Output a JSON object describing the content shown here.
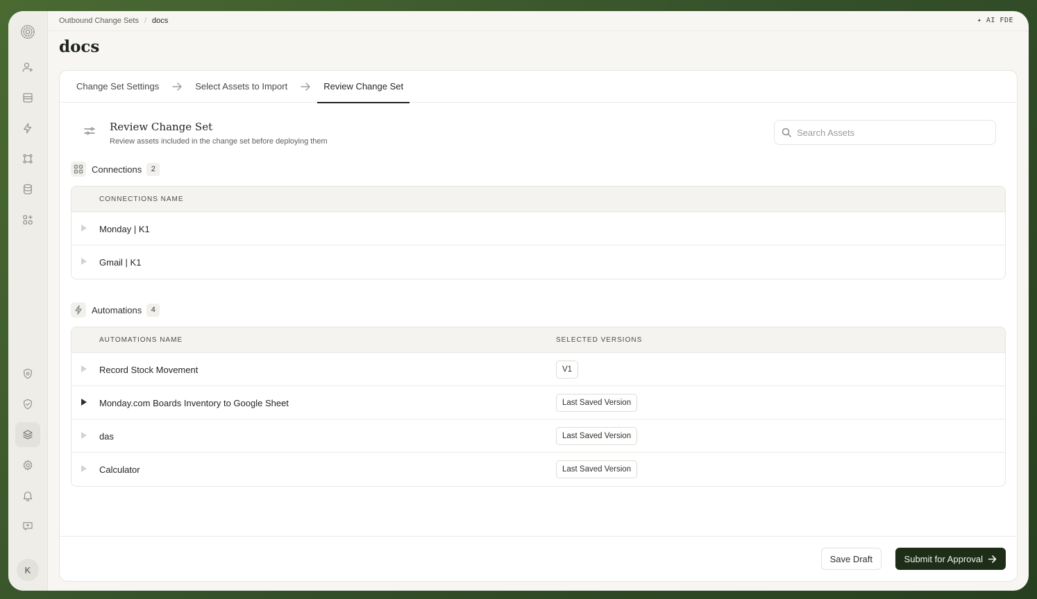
{
  "breadcrumb": {
    "parent": "Outbound Change Sets",
    "separator": "/",
    "current": "docs"
  },
  "topbar": {
    "ai_label": "✦ AI FDE"
  },
  "page": {
    "title": "docs"
  },
  "stepper": {
    "steps": [
      {
        "label": "Change Set Settings"
      },
      {
        "label": "Select Assets to Import"
      },
      {
        "label": "Review Change Set"
      }
    ],
    "active_index": 2
  },
  "review": {
    "title": "Review Change Set",
    "subtitle": "Review assets included in the change set before deploying them",
    "search_placeholder": "Search Assets"
  },
  "connections": {
    "label": "Connections",
    "count": "2",
    "column_name": "CONNECTIONS NAME",
    "rows": [
      {
        "name": "Monday | K1"
      },
      {
        "name": "Gmail | K1"
      }
    ]
  },
  "automations": {
    "label": "Automations",
    "count": "4",
    "column_name": "AUTOMATIONS NAME",
    "column_version": "SELECTED VERSIONS",
    "rows": [
      {
        "name": "Record Stock Movement",
        "version": "V1"
      },
      {
        "name": "Monday.com Boards Inventory to Google Sheet",
        "version": "Last Saved Version"
      },
      {
        "name": "das",
        "version": "Last Saved Version"
      },
      {
        "name": "Calculator",
        "version": "Last Saved Version"
      }
    ]
  },
  "footer": {
    "save_draft": "Save Draft",
    "submit": "Submit for Approval"
  },
  "user": {
    "initial": "K"
  },
  "colors": {
    "primary_button": "#1d2d17",
    "sidebar_bg": "#eeede8",
    "page_bg": "#f7f6f2"
  }
}
